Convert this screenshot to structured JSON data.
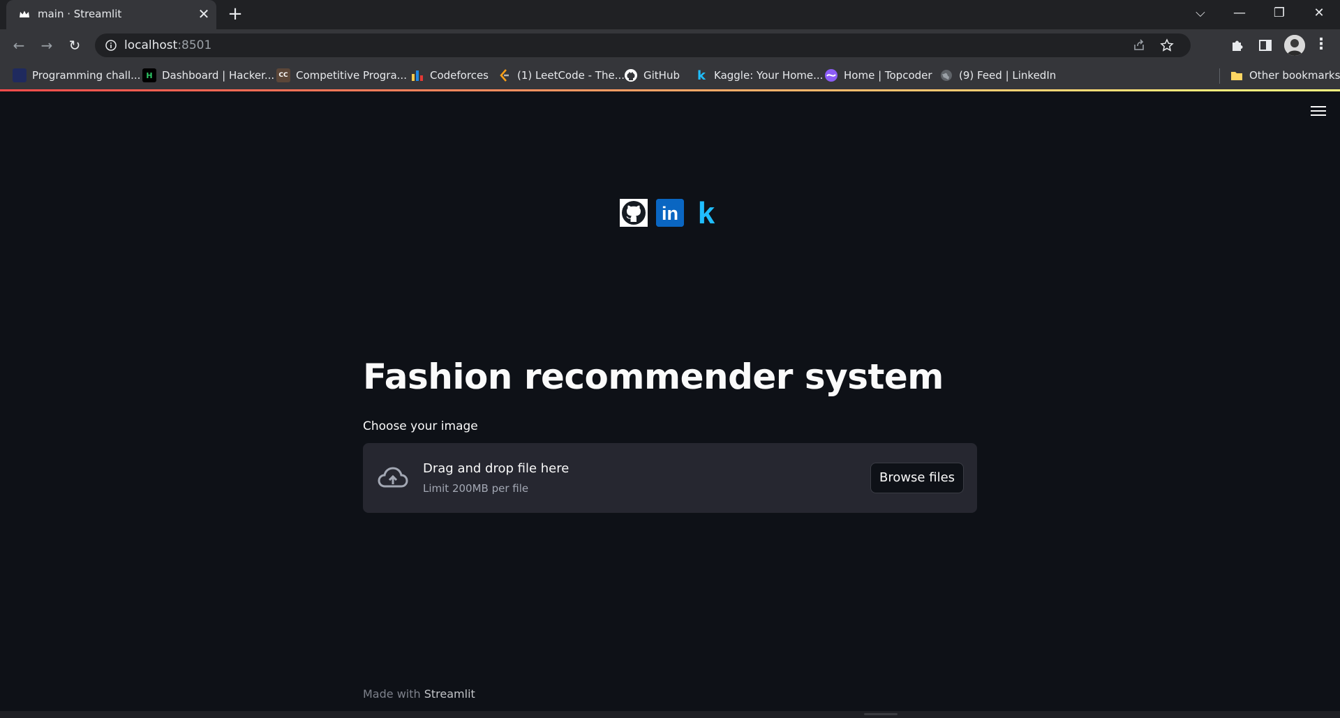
{
  "browser": {
    "tab_title": "main · Streamlit",
    "tab_close": "✕",
    "new_tab": "+",
    "url_host": "localhost",
    "url_port": ":8501",
    "window_controls": {
      "collapse": "⌵",
      "minimize": "—",
      "restore": "❐",
      "close": "✕"
    },
    "nav_glyphs": {
      "back": "←",
      "forward": "→",
      "reload": "↻"
    },
    "menu": "⋮"
  },
  "bookmarks": [
    {
      "label": "Programming chall...",
      "icon": "bookmark-programming-icon",
      "color": "#1f2a5e"
    },
    {
      "label": "Dashboard | Hacker...",
      "icon": "hackerearth-icon",
      "color": "#000000"
    },
    {
      "label": "Competitive Progra...",
      "icon": "codechef-icon",
      "color": "#5b4638"
    },
    {
      "label": "Codeforces",
      "icon": "codeforces-icon",
      "color": "#f2c94c"
    },
    {
      "label": "(1) LeetCode - The...",
      "icon": "leetcode-icon",
      "color": "#ffa116"
    },
    {
      "label": "GitHub",
      "icon": "github-icon",
      "color": "#ffffff"
    },
    {
      "label": "Kaggle: Your Home...",
      "icon": "kaggle-icon",
      "color": "#20beff"
    },
    {
      "label": "Home | Topcoder",
      "icon": "topcoder-icon",
      "color": "#8b5cf6"
    },
    {
      "label": "(9) Feed | LinkedIn",
      "icon": "globe-icon",
      "color": "#9aa0a6"
    }
  ],
  "other_bookmarks": "Other bookmarks",
  "app": {
    "social": {
      "kaggle_letter": "k",
      "linkedin_text": "in"
    },
    "title": "Fashion recommender system",
    "uploader_label": "Choose your image",
    "dropzone_title": "Drag and drop file here",
    "dropzone_limit": "Limit 200MB per file",
    "browse_button": "Browse files",
    "footer_prefix": "Made with ",
    "footer_brand": "Streamlit"
  },
  "colors": {
    "app_bg": "#0e1117",
    "dropzone_bg": "#262730",
    "accent_gradient_start": "#ff4b4b",
    "accent_gradient_end": "#fffd80",
    "linkedin_blue": "#0a66c2",
    "kaggle_blue": "#20beff"
  }
}
